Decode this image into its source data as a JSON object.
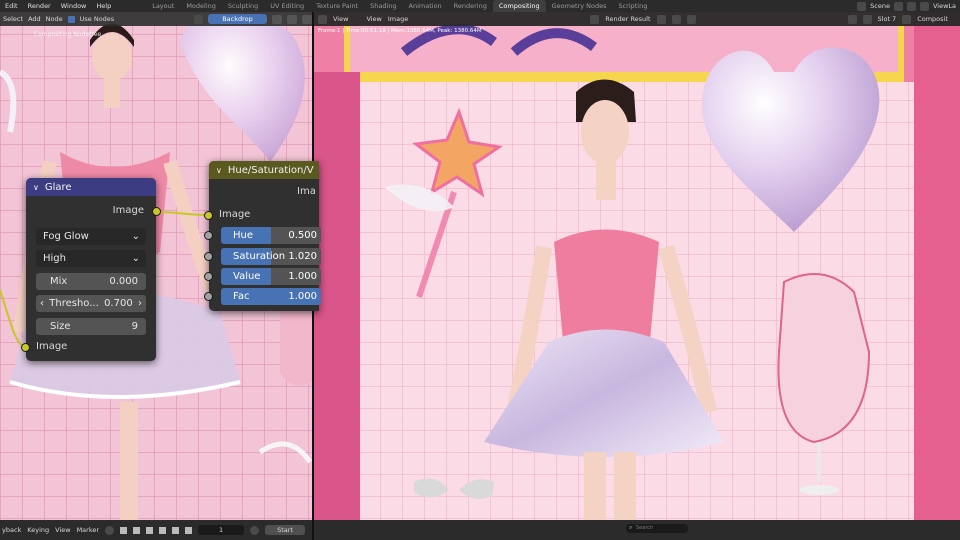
{
  "topbar": {
    "menus": [
      "Edit",
      "Render",
      "Window",
      "Help"
    ],
    "workspaces": [
      "Layout",
      "Modeling",
      "Sculpting",
      "UV Editing",
      "Texture Paint",
      "Shading",
      "Animation",
      "Rendering",
      "Compositing",
      "Geometry Nodes",
      "Scripting"
    ],
    "active_workspace": "Compositing",
    "scene_label": "Scene",
    "view_layer_label": "ViewLa"
  },
  "left_header": {
    "items": [
      "Select",
      "Add",
      "Node"
    ],
    "use_nodes_label": "Use Nodes",
    "backdrop_label": "Backdrop",
    "breadcrumb": "Compositing Nodetree"
  },
  "glare_node": {
    "title": "Glare",
    "output_label": "Image",
    "glare_type": "Fog Glow",
    "quality": "High",
    "mix_label": "Mix",
    "mix_value": "0.000",
    "threshold_label": "Thresho...",
    "threshold_value": "0.700",
    "size_label": "Size",
    "size_value": "9",
    "input_label": "Image",
    "header_color": "#3c3c83"
  },
  "hue_node": {
    "title": "Hue/Saturation/V",
    "output_label": "Ima",
    "input_image_label": "Image",
    "rows": [
      {
        "label": "Hue",
        "value": "0.500",
        "fill": 0.5
      },
      {
        "label": "Saturation",
        "value": "1.020",
        "fill": 0.5
      },
      {
        "label": "Value",
        "value": "1.000",
        "fill": 0.5
      },
      {
        "label": "Fac",
        "value": "1.000",
        "fill": 1.0
      }
    ],
    "header_color": "#595920"
  },
  "right_header": {
    "items": [
      "View",
      "View",
      "Image"
    ],
    "render_result_label": "Render Result",
    "slot_label": "Slot 7",
    "compositing_label": "Composit"
  },
  "frame_info": "Frame:1 | Time:00:51.18 | Mem:1380.64M, Peak: 1380.64M",
  "timeline": {
    "items": [
      "yback",
      "Keying",
      "View",
      "Marker"
    ],
    "current_frame": "1",
    "start_label": "Start"
  },
  "statusbar": {
    "search_placeholder": "Search"
  },
  "colors": {
    "accent_blue": "#4772b3",
    "socket_yellow": "#c7c729",
    "socket_gray": "#a1a1a1",
    "backdrop_pink": "#e8a8c2"
  }
}
